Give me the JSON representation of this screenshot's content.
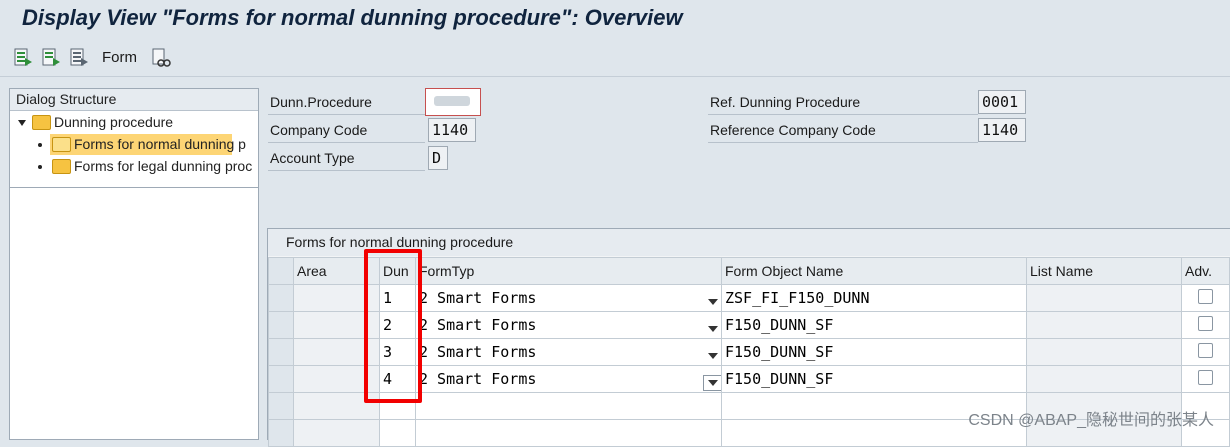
{
  "window": {
    "title": "Display View \"Forms for normal dunning procedure\": Overview"
  },
  "toolbar": {
    "form_label": "Form",
    "icons": [
      "expand-icon",
      "collapse-icon",
      "list-icon",
      "display-glasses-icon"
    ]
  },
  "tree": {
    "header": "Dialog Structure",
    "items": [
      {
        "label": "Dunning procedure",
        "level": 0,
        "expanded": true,
        "selected": false
      },
      {
        "label": "Forms for normal dunning p",
        "level": 1,
        "selected": true
      },
      {
        "label": "Forms for legal dunning proc",
        "level": 1,
        "selected": false
      }
    ]
  },
  "header_fields": {
    "dunn_procedure": {
      "label": "Dunn.Procedure",
      "value": ""
    },
    "company_code": {
      "label": "Company Code",
      "value": "1140"
    },
    "account_type": {
      "label": "Account Type",
      "value": "D"
    },
    "ref_dunning_procedure": {
      "label": "Ref. Dunning Procedure",
      "value": "0001"
    },
    "reference_company_code": {
      "label": "Reference Company Code",
      "value": "1140"
    }
  },
  "grid": {
    "title": "Forms for normal dunning procedure",
    "columns": [
      "Area",
      "Dun",
      "FormTyp",
      "Form Object Name",
      "List Name",
      "Adv."
    ],
    "rows": [
      {
        "area": "",
        "dun": "1",
        "formtyp": "2 Smart Forms",
        "form_object": "ZSF_FI_F150_DUNN",
        "list_name": "",
        "adv": false
      },
      {
        "area": "",
        "dun": "2",
        "formtyp": "2 Smart Forms",
        "form_object": "F150_DUNN_SF",
        "list_name": "",
        "adv": false
      },
      {
        "area": "",
        "dun": "3",
        "formtyp": "2 Smart Forms",
        "form_object": "F150_DUNN_SF",
        "list_name": "",
        "adv": false
      },
      {
        "area": "",
        "dun": "4",
        "formtyp": "2 Smart Forms",
        "form_object": "F150_DUNN_SF",
        "list_name": "",
        "adv": false
      }
    ]
  },
  "watermark": "CSDN @ABAP_隐秘世间的张某人",
  "colors": {
    "highlight_box": "#f20000",
    "tree_selected": "#fdd575",
    "title_text": "#10243e"
  }
}
